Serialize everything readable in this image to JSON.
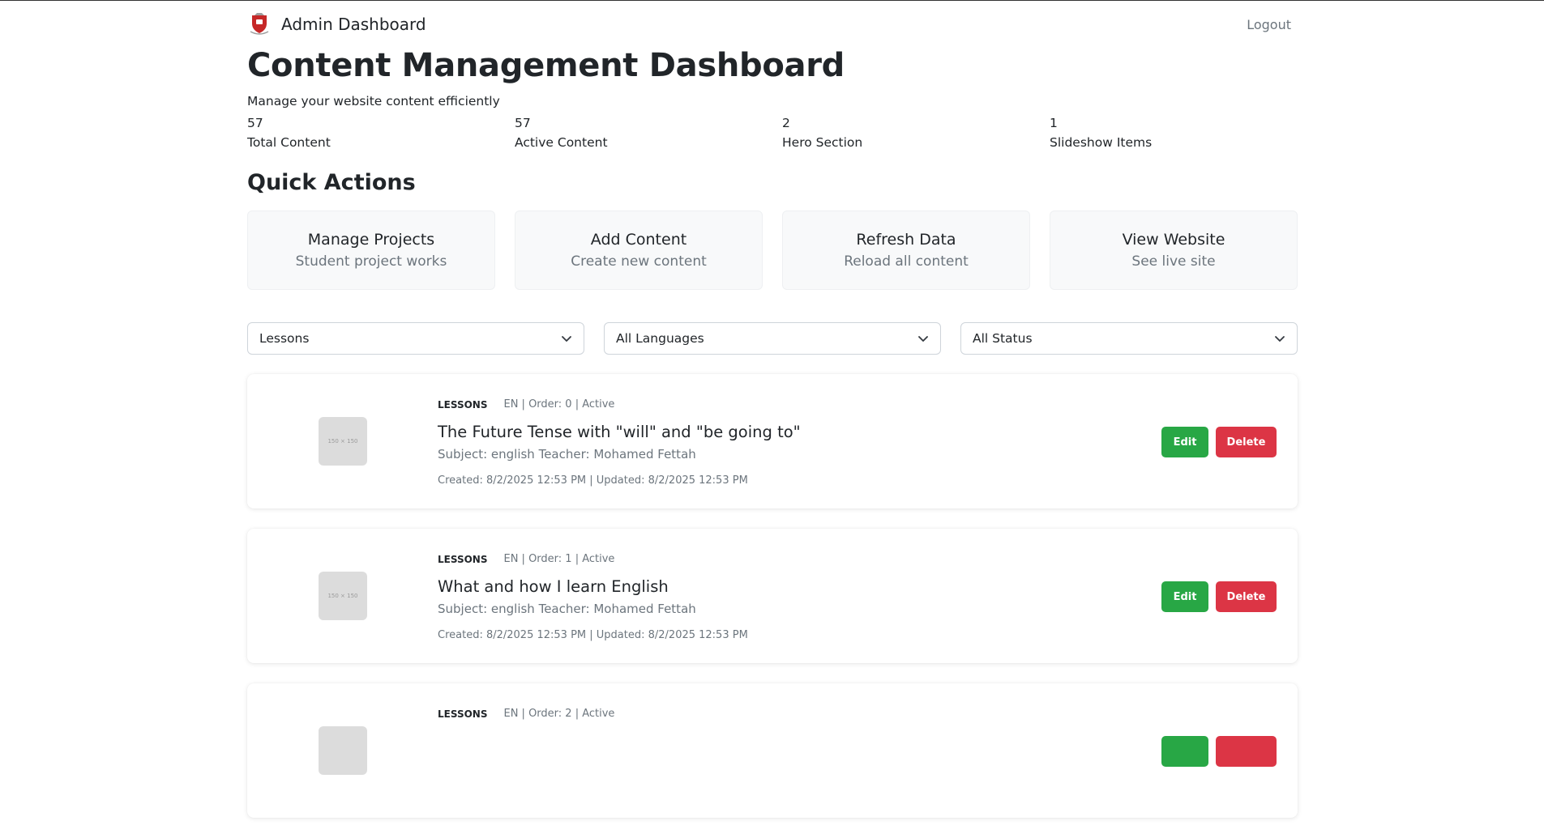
{
  "header": {
    "brand": "Admin Dashboard",
    "logout_label": "Logout",
    "logo_icon": "shield-crest-icon",
    "logo_color": "#c62828"
  },
  "page": {
    "title": "Content Management Dashboard",
    "subtitle": "Manage your website content efficiently"
  },
  "stats": [
    {
      "value": "57",
      "label": "Total Content"
    },
    {
      "value": "57",
      "label": "Active Content"
    },
    {
      "value": "2",
      "label": "Hero Section"
    },
    {
      "value": "1",
      "label": "Slideshow Items"
    }
  ],
  "quick_actions": {
    "title": "Quick Actions",
    "items": [
      {
        "title": "Manage Projects",
        "desc": "Student project works"
      },
      {
        "title": "Add Content",
        "desc": "Create new content"
      },
      {
        "title": "Refresh Data",
        "desc": "Reload all content"
      },
      {
        "title": "View Website",
        "desc": "See live site"
      }
    ]
  },
  "filters": {
    "type": "Lessons",
    "language": "All Languages",
    "status": "All Status"
  },
  "content_items": [
    {
      "tag": "LESSONS",
      "meta": "EN | Order: 0 | Active",
      "title": "The Future Tense with \"will\" and \"be going to\"",
      "subtitle": "Subject: english Teacher: Mohamed Fettah",
      "dates": "Created: 8/2/2025 12:53 PM | Updated: 8/2/2025 12:53 PM",
      "thumb_label": "150 × 150",
      "edit_label": "Edit",
      "delete_label": "Delete"
    },
    {
      "tag": "LESSONS",
      "meta": "EN | Order: 1 | Active",
      "title": "What and how I learn English",
      "subtitle": "Subject: english Teacher: Mohamed Fettah",
      "dates": "Created: 8/2/2025 12:53 PM | Updated: 8/2/2025 12:53 PM",
      "thumb_label": "150 × 150",
      "edit_label": "Edit",
      "delete_label": "Delete"
    },
    {
      "tag": "LESSONS",
      "meta": "EN | Order: 2 | Active",
      "title": "",
      "subtitle": "",
      "dates": "",
      "thumb_label": "",
      "edit_label": "",
      "delete_label": ""
    }
  ],
  "colors": {
    "edit": "#28a745",
    "delete": "#dc3545",
    "card_bg": "#f8f9fa"
  }
}
